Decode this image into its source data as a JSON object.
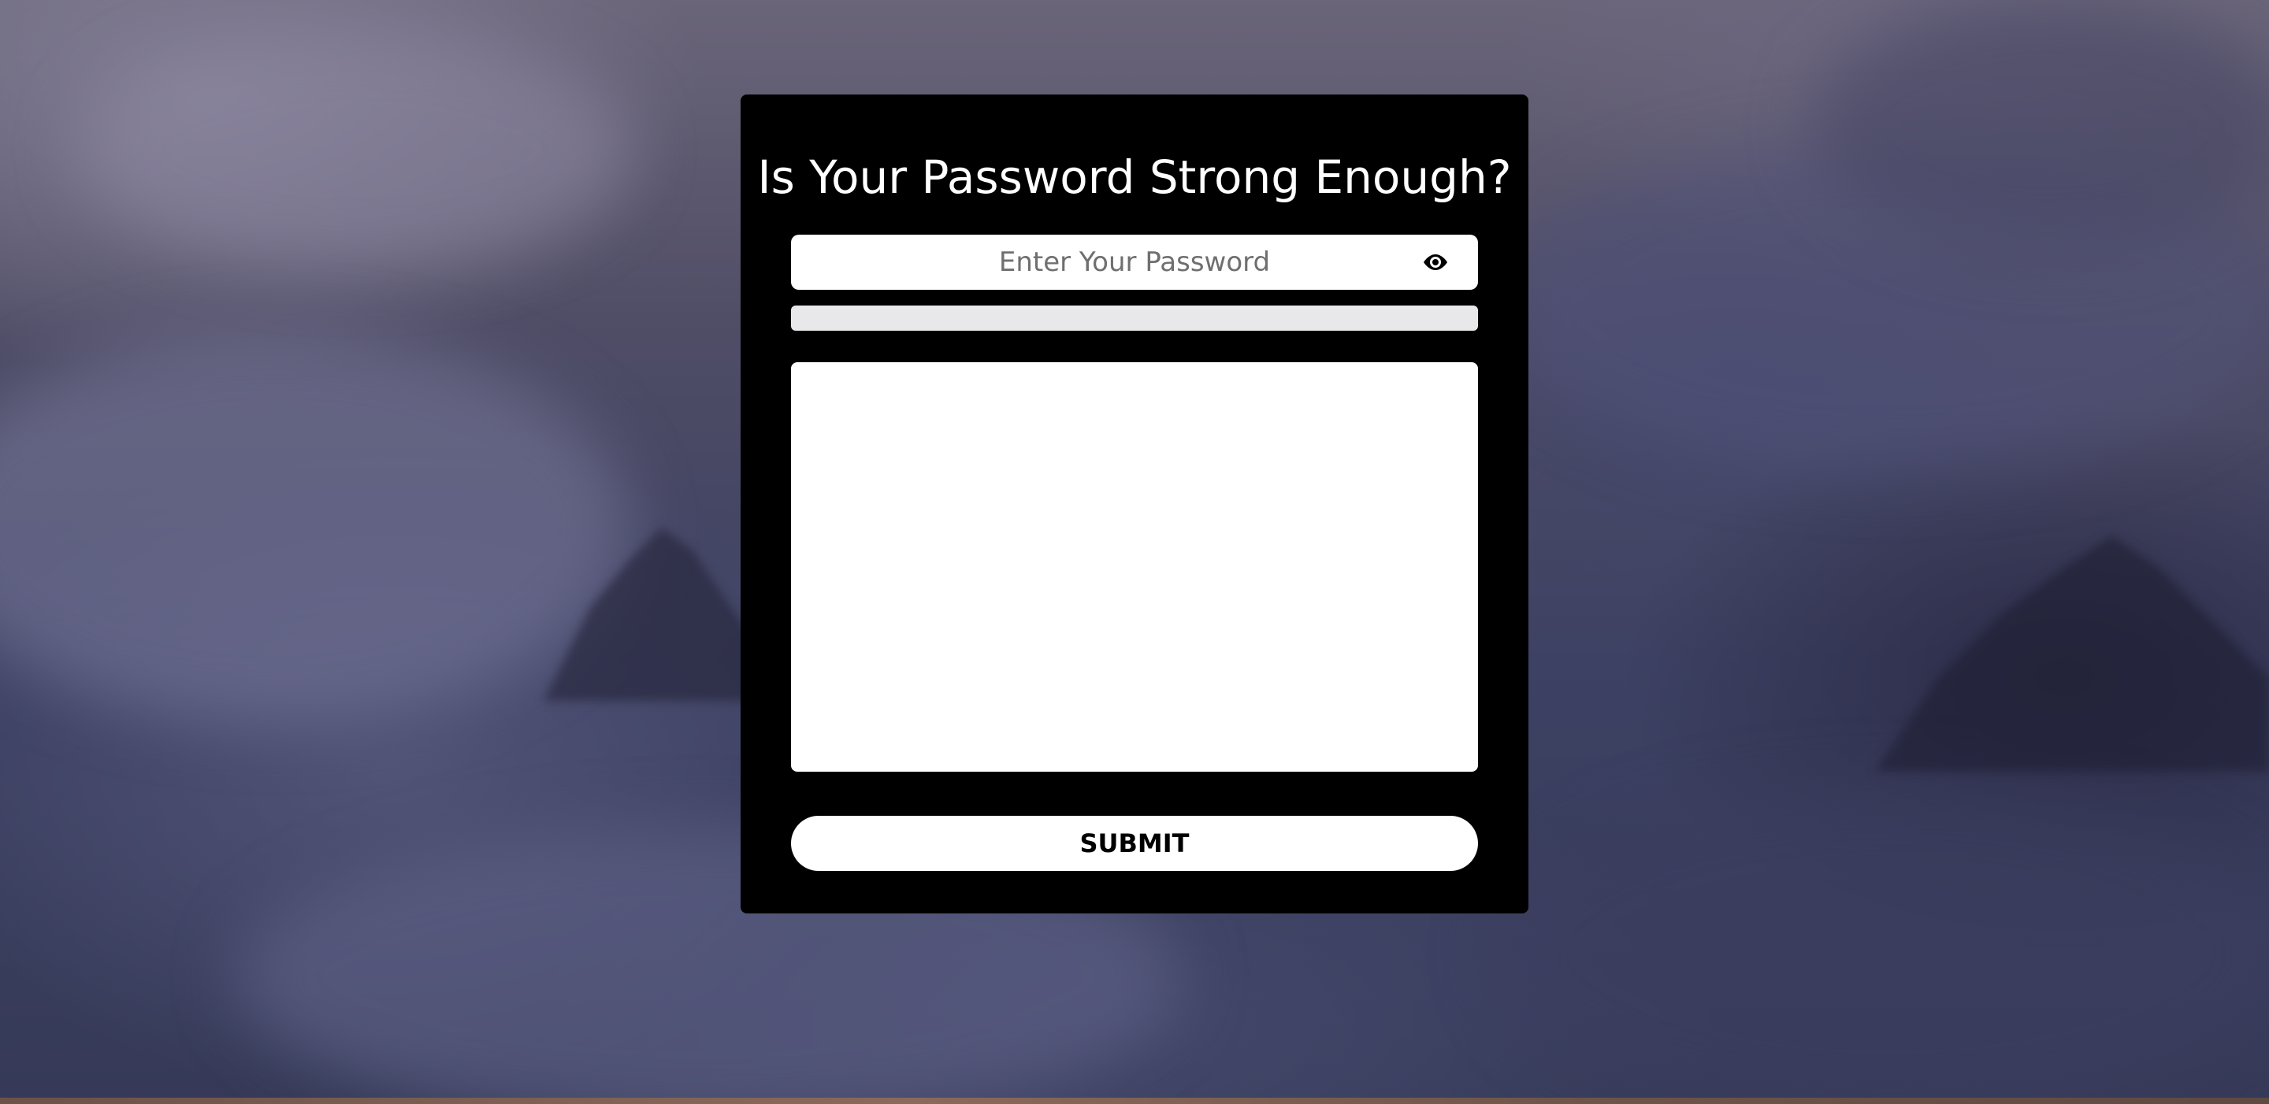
{
  "page": {
    "title": "Is Your Password Strong Enough?"
  },
  "password": {
    "placeholder": "Enter Your Password",
    "value": "",
    "toggle_icon": "eye-icon"
  },
  "strength": {
    "level": 0
  },
  "feedback": {
    "text": ""
  },
  "submit": {
    "label": "SUBMIT"
  },
  "colors": {
    "card_background": "#000000",
    "field_background": "#ffffff",
    "strength_track": "#e8e8ea",
    "title_text": "#ffffff",
    "button_text": "#000000"
  }
}
